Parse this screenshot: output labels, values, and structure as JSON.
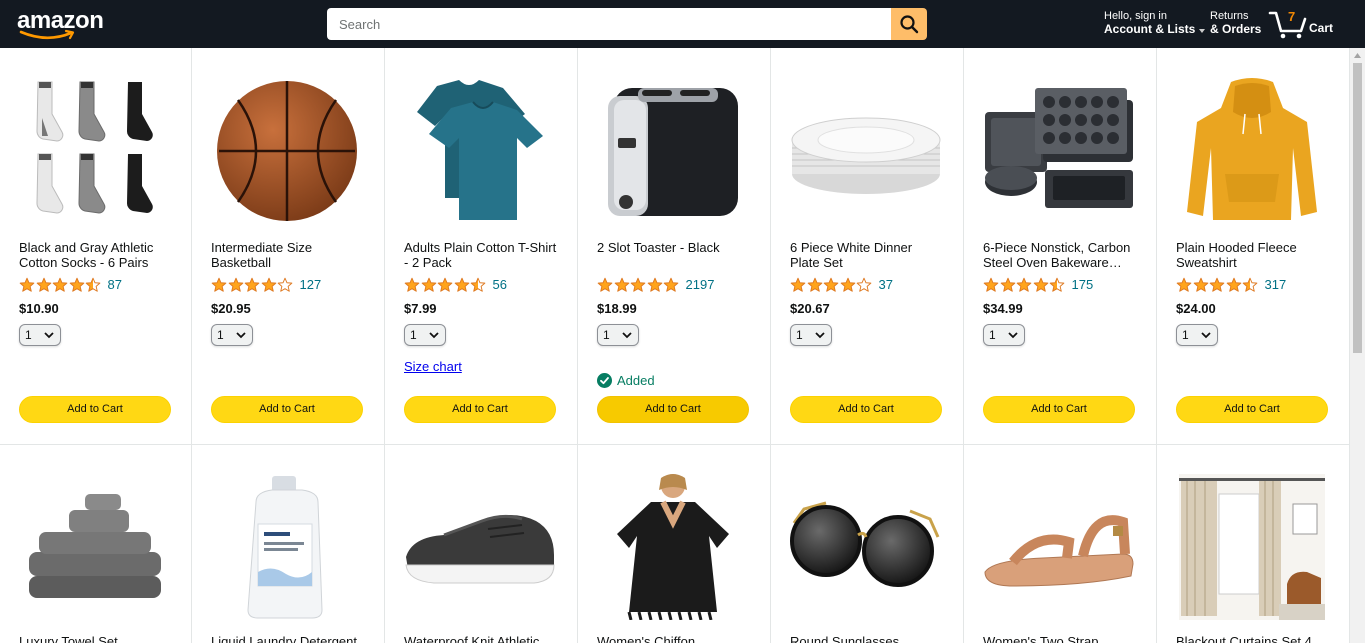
{
  "header": {
    "logo_text": "amazon",
    "search_placeholder": "Search",
    "account_small": "Hello, sign in",
    "account_bold": "Account & Lists",
    "returns_small": "Returns",
    "returns_bold": "& Orders",
    "cart_count": "7",
    "cart_label": "Cart"
  },
  "products_row1": [
    {
      "title": "Black and Gray Athletic Cotton Socks - 6 Pairs",
      "rating": 4.5,
      "rating_count": "87",
      "price": "$10.90",
      "qty": "1",
      "add_label": "Add to Cart",
      "image": "socks"
    },
    {
      "title": "Intermediate Size Basketball",
      "rating": 4.0,
      "rating_count": "127",
      "price": "$20.95",
      "qty": "1",
      "add_label": "Add to Cart",
      "image": "basketball"
    },
    {
      "title": "Adults Plain Cotton T-Shirt - 2 Pack",
      "rating": 4.5,
      "rating_count": "56",
      "price": "$7.99",
      "qty": "1",
      "add_label": "Add to Cart",
      "link": "Size chart",
      "image": "tshirt"
    },
    {
      "title": "2 Slot Toaster - Black",
      "rating": 5.0,
      "rating_count": "2197",
      "price": "$18.99",
      "qty": "1",
      "add_label": "Add to Cart",
      "status": "Added",
      "image": "toaster"
    },
    {
      "title": "6 Piece White Dinner Plate Set",
      "rating": 4.0,
      "rating_count": "37",
      "price": "$20.67",
      "qty": "1",
      "add_label": "Add to Cart",
      "image": "plates"
    },
    {
      "title": "6-Piece Nonstick, Carbon Steel Oven Bakeware…",
      "rating": 4.5,
      "rating_count": "175",
      "price": "$34.99",
      "qty": "1",
      "add_label": "Add to Cart",
      "image": "bakeware"
    },
    {
      "title": "Plain Hooded Fleece Sweatshirt",
      "rating": 4.5,
      "rating_count": "317",
      "price": "$24.00",
      "qty": "1",
      "add_label": "Add to Cart",
      "image": "hoodie"
    }
  ],
  "products_row2": [
    {
      "title": "Luxury Towel Set",
      "image": "towels"
    },
    {
      "title": "Liquid Laundry Detergent",
      "image": "detergent"
    },
    {
      "title": "Waterproof Knit Athletic",
      "image": "sneaker"
    },
    {
      "title": "Women's Chiffon",
      "image": "coverup"
    },
    {
      "title": "Round Sunglasses",
      "image": "sunglasses"
    },
    {
      "title": "Women's Two Strap",
      "image": "sandal"
    },
    {
      "title": "Blackout Curtains Set 4",
      "image": "curtains"
    }
  ],
  "colors": {
    "header_bg": "#131921",
    "search_button": "#febd69",
    "add_to_cart": "#ffd814",
    "star": "#ffa41c",
    "link": "#007185",
    "added": "#067d62"
  }
}
